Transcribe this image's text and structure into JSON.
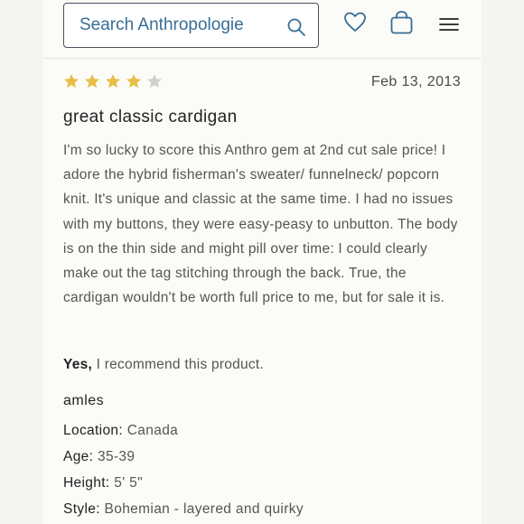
{
  "header": {
    "search_placeholder": "Search Anthropologie",
    "icons": {
      "search": "search-icon",
      "wishlist": "heart-icon",
      "bag": "shopping-bag-icon",
      "menu": "hamburger-menu-icon"
    }
  },
  "review": {
    "rating": 4,
    "rating_max": 5,
    "date": "Feb 13, 2013",
    "title": "great classic cardigan",
    "body": "I'm so lucky to score this Anthro gem at 2nd cut sale price! I adore the hybrid fisherman's sweater/ funnelneck/ popcorn knit. It's unique and classic at the same time. I had no issues with my buttons, they were easy-peasy to unbutton. The body is on the thin side and might pill over time: I could clearly make out the tag stitching through the back. True, the cardigan wouldn't be worth full price to me, but for sale it is.",
    "recommend_yes": "Yes,",
    "recommend_text": "I recommend this product.",
    "author": "amles",
    "details": {
      "location_label": "Location:",
      "location": "Canada",
      "age_label": "Age:",
      "age": "35-39",
      "height_label": "Height:",
      "height": "5' 5\"",
      "style_label": "Style:",
      "style": "Bohemian - layered and quirky"
    }
  },
  "colors": {
    "accent": "#376d95",
    "star_filled": "#e7bd45",
    "star_empty": "#cfcfcf"
  }
}
